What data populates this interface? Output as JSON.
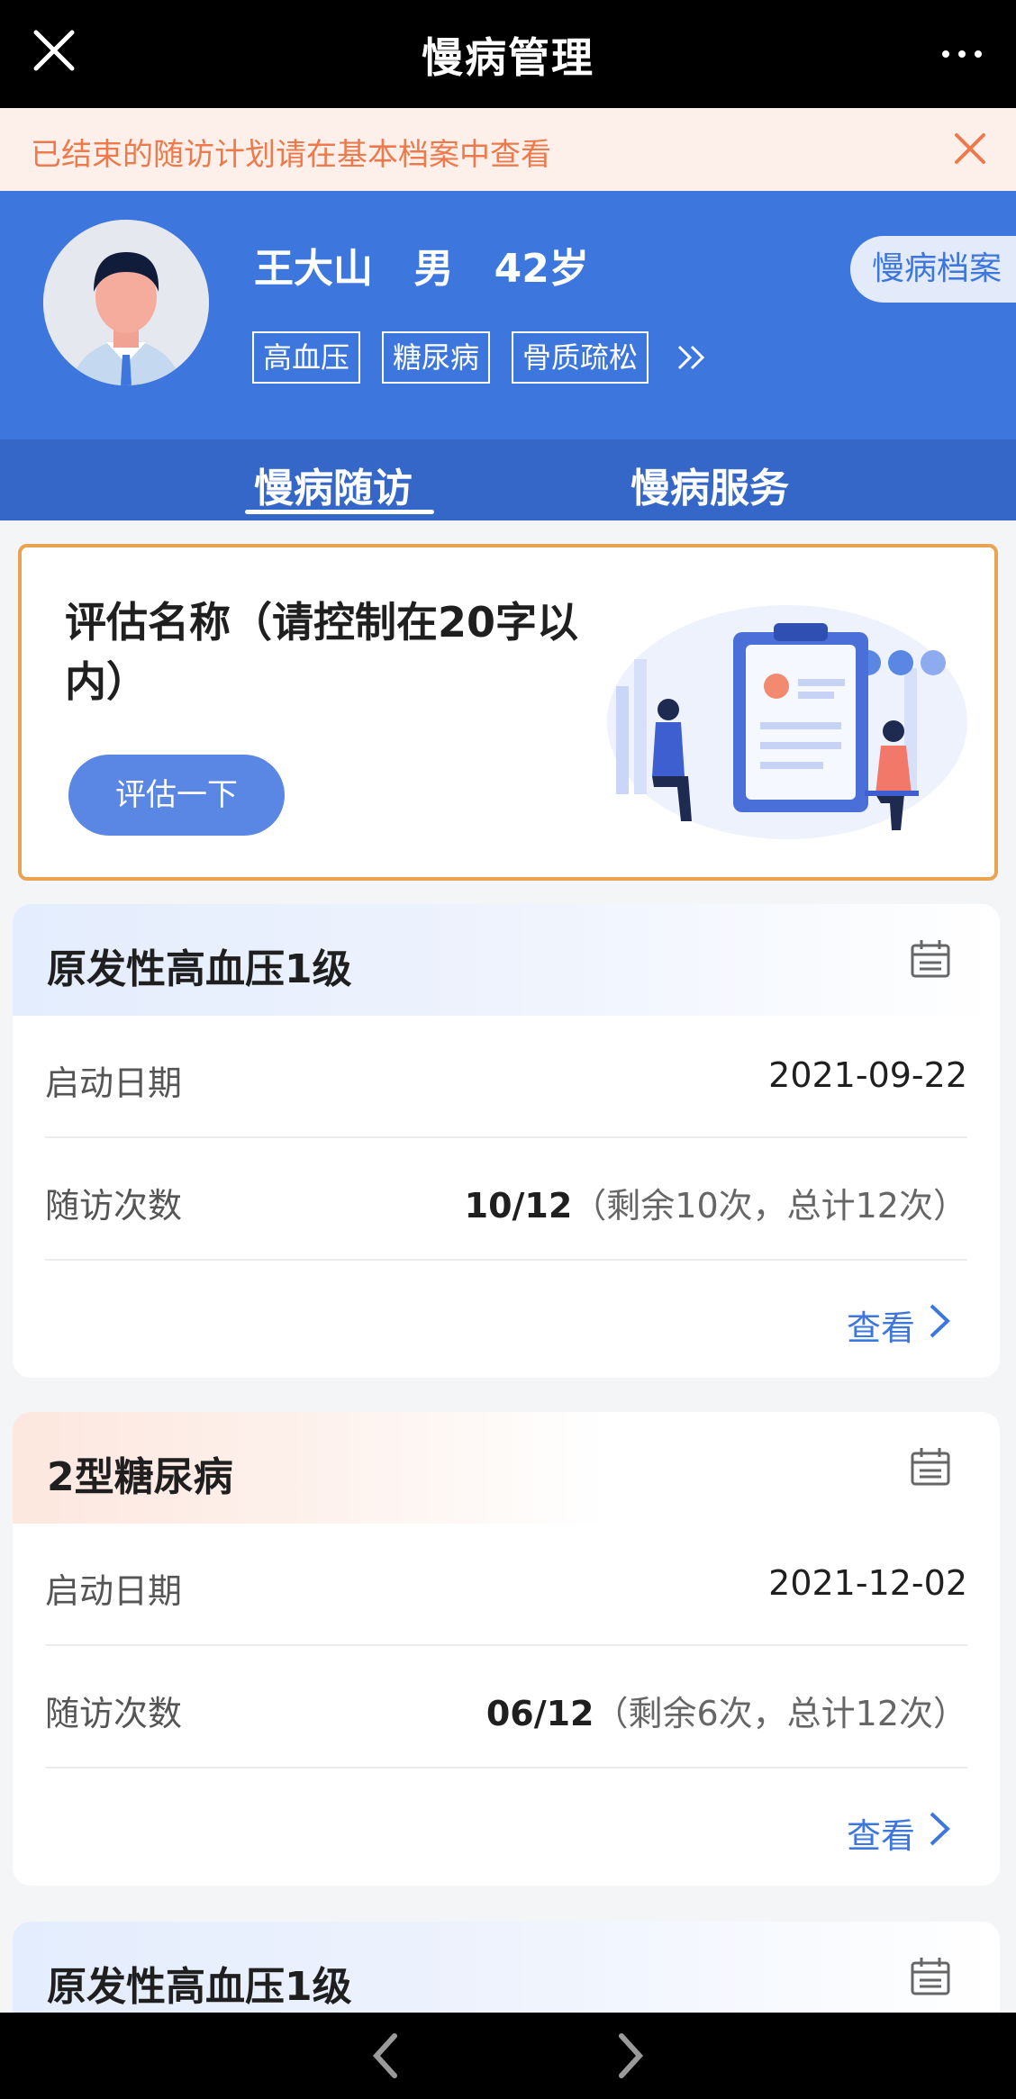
{
  "header": {
    "title": "慢病管理"
  },
  "notice": {
    "text": "已结束的随访计划请在基本档案中查看"
  },
  "profile": {
    "name": "王大山",
    "gender": "男",
    "age": "42岁",
    "tags": [
      "高血压",
      "糖尿病",
      "骨质疏松"
    ],
    "archive_label": "慢病档案"
  },
  "tabs": [
    {
      "label": "慢病随访",
      "active": true
    },
    {
      "label": "慢病服务",
      "active": false
    }
  ],
  "assessment": {
    "title": "评估名称（请控制在20字以内）",
    "button_label": "评估一下"
  },
  "cards": [
    {
      "title": "原发性高血压1级",
      "start_label": "启动日期",
      "start_date": "2021-09-22",
      "count_label": "随访次数",
      "count_value": "10/12",
      "count_detail": "（剩余10次，总计12次）",
      "view_label": "查看"
    },
    {
      "title": "2型糖尿病",
      "start_label": "启动日期",
      "start_date": "2021-12-02",
      "count_label": "随访次数",
      "count_value": "06/12",
      "count_detail": "（剩余6次，总计12次）",
      "view_label": "查看"
    },
    {
      "title": "原发性高血压1级"
    }
  ],
  "colors": {
    "primary": "#3d77dd",
    "notice_text": "#ec7a4c",
    "notice_bg": "#fdf0ea",
    "assessment_border": "#e8a451"
  }
}
